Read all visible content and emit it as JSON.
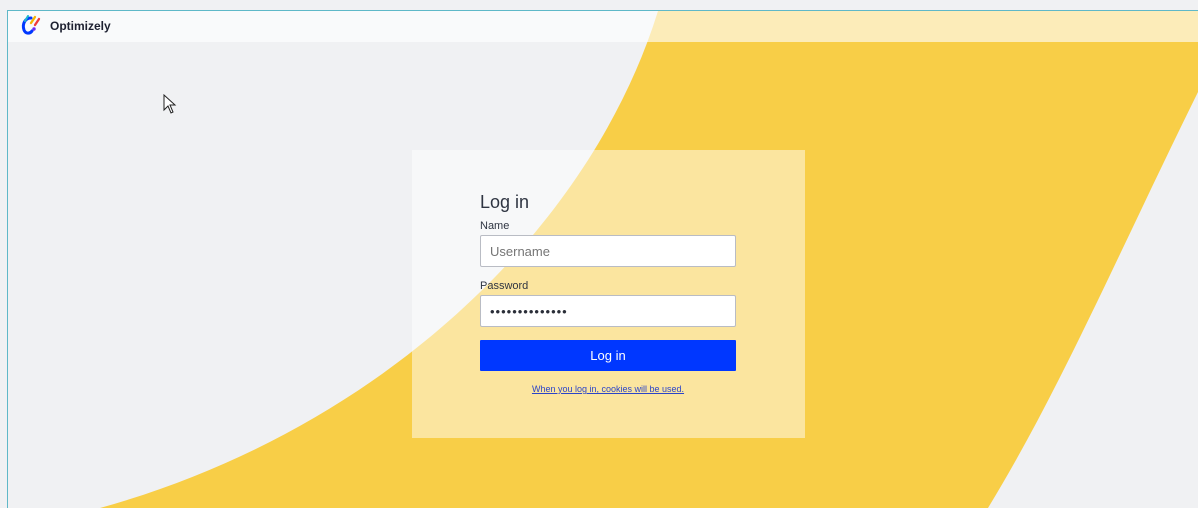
{
  "header": {
    "brand": "Optimizely",
    "logo_icon": "optimizely-logo-icon"
  },
  "login": {
    "title": "Log in",
    "name_label": "Name",
    "username_placeholder": "Username",
    "password_label": "Password",
    "password_value": "••••••••••••••",
    "submit_label": "Log in",
    "cookie_notice": "When you log in, cookies will be used."
  },
  "colors": {
    "page_background": "#f0f1f3",
    "accent_yellow": "#f8ce47",
    "primary_button": "#0037ff",
    "link": "#2b44c8"
  },
  "cursor": {
    "icon": "mouse-pointer-icon"
  }
}
